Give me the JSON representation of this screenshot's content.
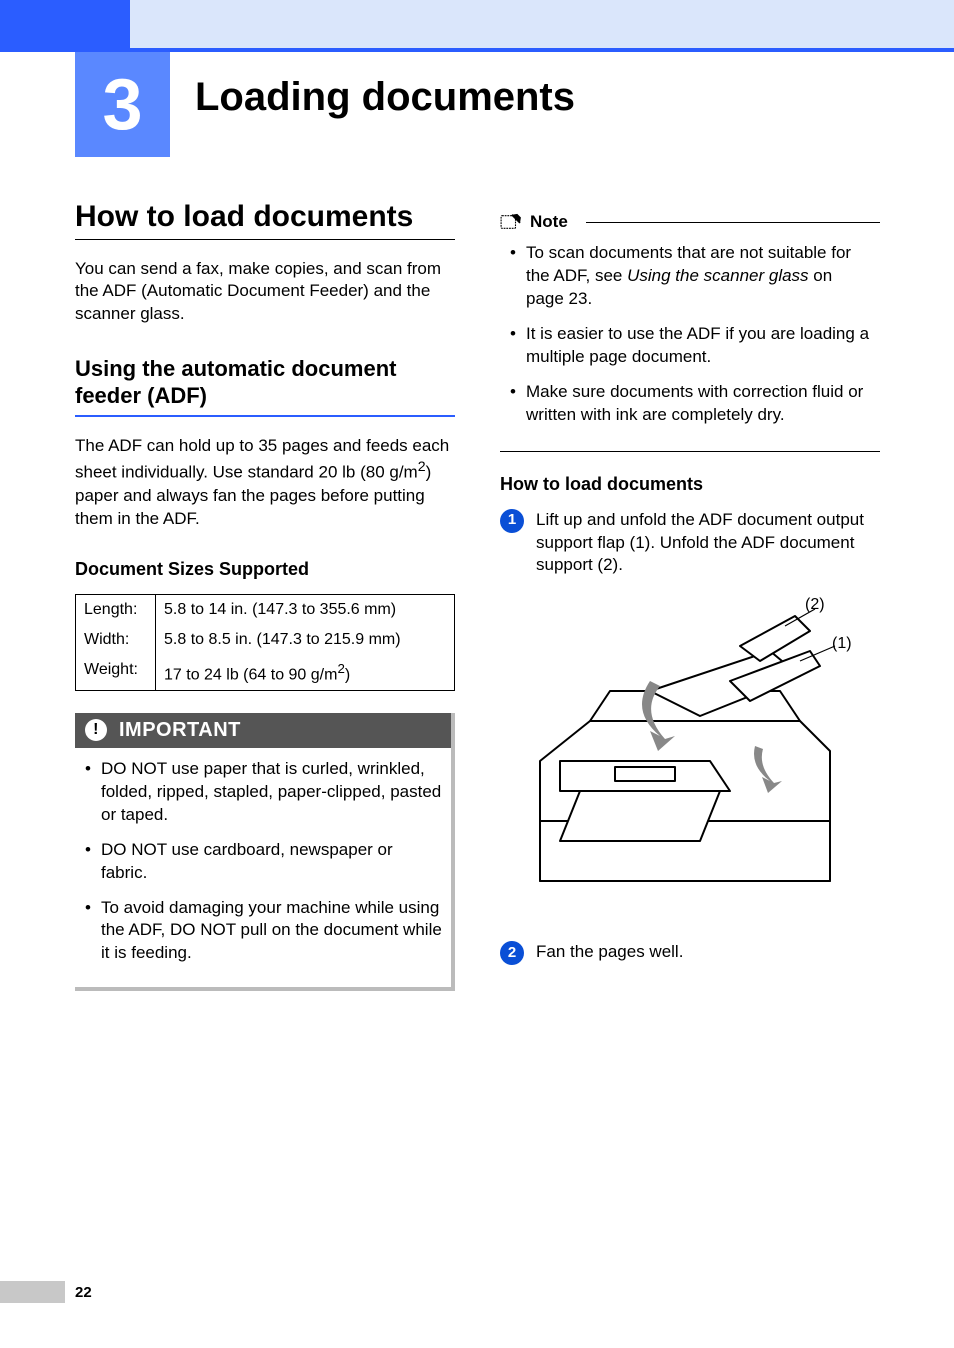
{
  "chapter": {
    "number": "3",
    "title": "Loading documents"
  },
  "left": {
    "h1": "How to load documents",
    "intro": "You can send a fax, make copies, and scan from the ADF (Automatic Document Feeder) and the scanner glass.",
    "h2": "Using the automatic document feeder (ADF)",
    "adf_body_a": "The ADF can hold up to 35 pages and feeds each sheet individually. Use standard 20 lb (80 g/m",
    "adf_body_b": ") paper and always fan the pages before putting them in the ADF.",
    "sizes_h": "Document Sizes Supported",
    "sizes": {
      "rows": [
        {
          "label": "Length:",
          "value": "5.8 to 14 in. (147.3 to 355.6 mm)"
        },
        {
          "label": "Width:",
          "value": "5.8 to 8.5 in. (147.3 to 215.9 mm)"
        },
        {
          "label": "Weight:",
          "value_a": "17 to 24 lb (64 to 90 g/m",
          "value_b": ")"
        }
      ]
    },
    "important": {
      "header": "IMPORTANT",
      "items": [
        "DO NOT use paper that is curled, wrinkled, folded, ripped, stapled, paper-clipped, pasted or taped.",
        "DO NOT use cardboard, newspaper or fabric.",
        "To avoid damaging your machine while using the ADF, DO NOT pull on the document while it is feeding."
      ]
    }
  },
  "right": {
    "note": {
      "label": "Note",
      "items_a": "To scan documents that are not suitable for the ADF, see ",
      "items_a_em": "Using the scanner glass",
      "items_a_tail": " on page 23.",
      "items_b": "It is easier to use the ADF if you are loading a multiple page document.",
      "items_c": "Make sure documents with correction fluid or written with ink are completely dry."
    },
    "howto_h": "How to load documents",
    "steps": {
      "s1": "Lift up and unfold the ADF document output support flap (1). Unfold the ADF document support (2).",
      "s2": "Fan the pages well."
    },
    "callouts": {
      "c1": "(1)",
      "c2": "(2)"
    }
  },
  "page_number": "22"
}
